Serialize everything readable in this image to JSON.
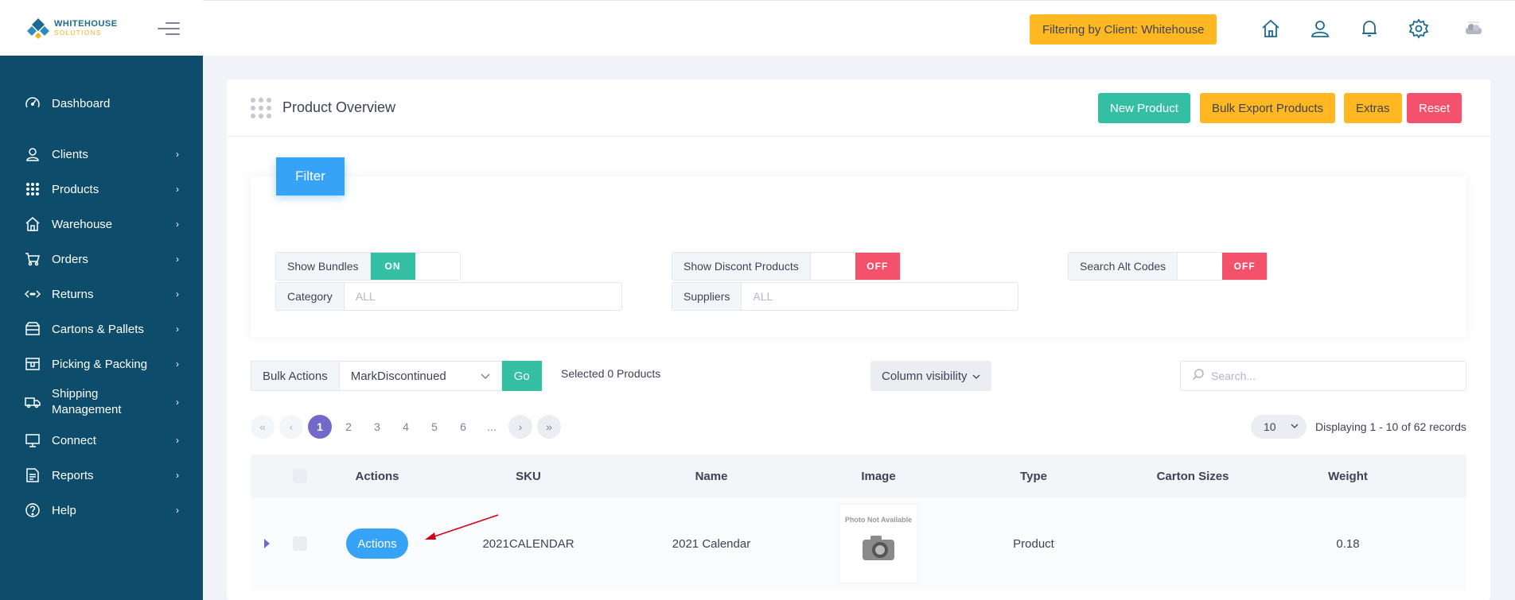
{
  "brand": {
    "line1": "WHITEHOUSE",
    "line2": "SOLUTIONS"
  },
  "sidebar": {
    "items": [
      {
        "label": "Dashboard",
        "icon": "dashboard-icon",
        "chevron": false
      },
      {
        "label": "Clients",
        "icon": "clients-icon",
        "chevron": true
      },
      {
        "label": "Products",
        "icon": "products-icon",
        "chevron": true
      },
      {
        "label": "Warehouse",
        "icon": "warehouse-icon",
        "chevron": true
      },
      {
        "label": "Orders",
        "icon": "orders-icon",
        "chevron": true
      },
      {
        "label": "Returns",
        "icon": "returns-icon",
        "chevron": true
      },
      {
        "label": "Cartons & Pallets",
        "icon": "cartons-icon",
        "chevron": true
      },
      {
        "label": "Picking & Packing",
        "icon": "picking-icon",
        "chevron": true
      },
      {
        "label": "Shipping\nManagement",
        "icon": "shipping-icon",
        "chevron": true
      },
      {
        "label": "Connect",
        "icon": "connect-icon",
        "chevron": true
      },
      {
        "label": "Reports",
        "icon": "reports-icon",
        "chevron": true
      },
      {
        "label": "Help",
        "icon": "help-icon",
        "chevron": true
      }
    ]
  },
  "topbar": {
    "filter_label": "Filtering by Client: Whitehouse",
    "icons": [
      "home-icon",
      "user-icon",
      "bell-icon",
      "gear-icon",
      "avatar"
    ]
  },
  "card": {
    "title": "Product Overview",
    "buttons": {
      "new_product": "New Product",
      "bulk_export": "Bulk Export Products",
      "extras": "Extras",
      "reset": "Reset"
    }
  },
  "filter": {
    "tab_label": "Filter",
    "show_bundles_label": "Show Bundles",
    "show_bundles_state": "ON",
    "show_discont_label": "Show Discont Products",
    "show_discont_state": "OFF",
    "search_alt_label": "Search Alt Codes",
    "search_alt_state": "OFF",
    "category_label": "Category",
    "category_value": "ALL",
    "suppliers_label": "Suppliers",
    "suppliers_value": "ALL"
  },
  "toolbar": {
    "bulk_label": "Bulk Actions",
    "bulk_selected": "MarkDiscontinued",
    "go_label": "Go",
    "selected_text": "Selected 0 Products",
    "column_visibility": "Column visibility",
    "search_placeholder": "Search..."
  },
  "pagination": {
    "pages": [
      "1",
      "2",
      "3",
      "4",
      "5",
      "6",
      "..."
    ],
    "current": "1",
    "per_page": "10",
    "records_text": "Displaying 1 - 10 of 62 records"
  },
  "table": {
    "columns": [
      "Actions",
      "SKU",
      "Name",
      "Image",
      "Type",
      "Carton Sizes",
      "Weight"
    ],
    "rows": [
      {
        "actions": "Actions",
        "sku": "2021CALENDAR",
        "name": "2021 Calendar",
        "image_text": "Photo Not Available",
        "type": "Product",
        "carton_sizes": "",
        "weight": "0.18"
      }
    ]
  },
  "colors": {
    "sidebar": "#0d4d6b",
    "accent_yellow": "#ffb822",
    "accent_green": "#34bfa3",
    "accent_red": "#f4516c",
    "accent_blue": "#36a3f7",
    "accent_purple": "#716aca",
    "annotation_arrow": "#d0021b"
  }
}
